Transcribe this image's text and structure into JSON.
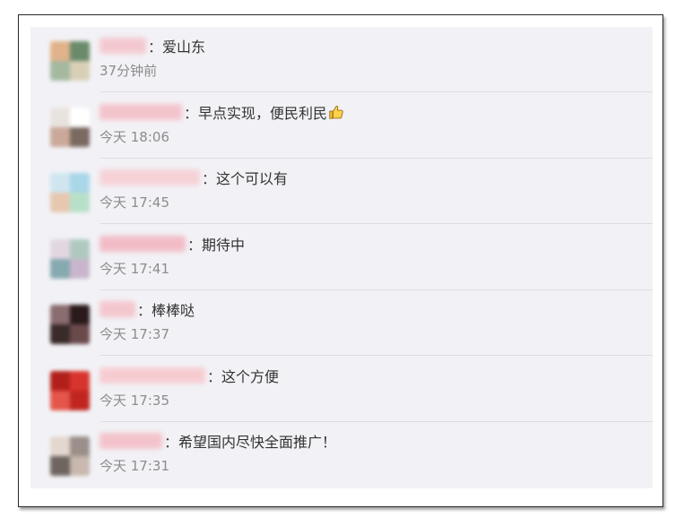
{
  "comments": [
    {
      "text": "爱山东",
      "time": "37分钟前",
      "avatar_colors": [
        "#6a8a6a",
        "#d9cfb6",
        "#a5b8a0",
        "#e0b38a"
      ],
      "nick_color": "#f3c9cf",
      "nick_width": 52,
      "has_thumb": false
    },
    {
      "text": "早点实现，便民利民",
      "time": "今天 18:06",
      "avatar_colors": [
        "#ffffff",
        "#7a6a60",
        "#caa99a",
        "#e9e3df"
      ],
      "nick_color": "#f3c3cc",
      "nick_width": 92,
      "has_thumb": true
    },
    {
      "text": "这个可以有",
      "time": "今天 17:45",
      "avatar_colors": [
        "#a9d6e8",
        "#b8e0c8",
        "#e6c8b0",
        "#cfe6f0"
      ],
      "nick_color": "#f6d2d7",
      "nick_width": 112,
      "has_thumb": false
    },
    {
      "text": "期待中",
      "time": "今天 17:41",
      "avatar_colors": [
        "#b0c9c0",
        "#c9b6cd",
        "#86a9b0",
        "#e2d6e2"
      ],
      "nick_color": "#f1bcc6",
      "nick_width": 96,
      "has_thumb": false
    },
    {
      "text": "棒棒哒",
      "time": "今天 17:37",
      "avatar_colors": [
        "#2a1a1c",
        "#6b4a4c",
        "#3a2a2a",
        "#8a6d70"
      ],
      "nick_color": "#f4c6cd",
      "nick_width": 40,
      "has_thumb": false
    },
    {
      "text": "这个方便",
      "time": "今天 17:35",
      "avatar_colors": [
        "#d8342e",
        "#c0261f",
        "#e4554a",
        "#b21f1a"
      ],
      "nick_color": "#f6ccd1",
      "nick_width": 118,
      "has_thumb": false
    },
    {
      "text": "希望国内尽快全面推广！",
      "time": "今天 17:31",
      "avatar_colors": [
        "#9a8f8a",
        "#c8b8ae",
        "#6f6560",
        "#e3d7cf"
      ],
      "nick_color": "#f3c2ca",
      "nick_width": 70,
      "has_thumb": false
    }
  ]
}
